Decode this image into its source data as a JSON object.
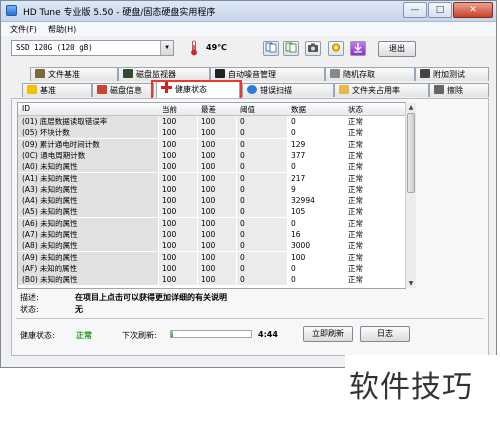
{
  "window": {
    "title": "HD Tune 专业版 5.50 - 硬盘/固态硬盘实用程序",
    "minimize": "—",
    "maximize": "□",
    "close": "✕"
  },
  "menu": {
    "file": "文件(F)",
    "help": "帮助(H)"
  },
  "toolbar": {
    "drive": "SSD 120G (120 gB)",
    "temperature": "49℃",
    "exit_label": "退出",
    "icons": [
      "copy-info-icon",
      "copy-screen-icon",
      "camera-icon",
      "options-icon",
      "download-icon"
    ]
  },
  "tabs_top": [
    {
      "label": "文件基准",
      "icon": "file-benchmark-icon"
    },
    {
      "label": "磁盘监视器",
      "icon": "disk-monitor-icon"
    },
    {
      "label": "自动噪音管理",
      "icon": "aam-icon"
    },
    {
      "label": "随机存取",
      "icon": "random-access-icon"
    },
    {
      "label": "附加测试",
      "icon": "extra-tests-icon"
    }
  ],
  "tabs_bottom": [
    {
      "label": "基准",
      "icon": "benchmark-icon"
    },
    {
      "label": "磁盘信息",
      "icon": "disk-info-icon"
    },
    {
      "label": "健康状态",
      "icon": "health-cross-icon",
      "active": true
    },
    {
      "label": "错误扫描",
      "icon": "error-scan-icon"
    },
    {
      "label": "文件夹占用率",
      "icon": "folder-usage-icon"
    },
    {
      "label": "擦除",
      "icon": "erase-icon"
    }
  ],
  "table": {
    "headers": [
      "ID",
      "当前",
      "最差",
      "阈值",
      "数据",
      "状态"
    ],
    "rows": [
      [
        "(01) 底层数据读取错误率",
        "100",
        "100",
        "0",
        "0",
        "正常"
      ],
      [
        "(05) 坏块计数",
        "100",
        "100",
        "0",
        "0",
        "正常"
      ],
      [
        "(09) 累计通电时间计数",
        "100",
        "100",
        "0",
        "129",
        "正常"
      ],
      [
        "(0C) 通电周期计数",
        "100",
        "100",
        "0",
        "377",
        "正常"
      ],
      [
        "(A0) 未知的属性",
        "100",
        "100",
        "0",
        "0",
        "正常"
      ],
      [
        "(A1) 未知的属性",
        "100",
        "100",
        "0",
        "217",
        "正常"
      ],
      [
        "(A3) 未知的属性",
        "100",
        "100",
        "0",
        "9",
        "正常"
      ],
      [
        "(A4) 未知的属性",
        "100",
        "100",
        "0",
        "32994",
        "正常"
      ],
      [
        "(A5) 未知的属性",
        "100",
        "100",
        "0",
        "105",
        "正常"
      ],
      [
        "(A6) 未知的属性",
        "100",
        "100",
        "0",
        "0",
        "正常"
      ],
      [
        "(A7) 未知的属性",
        "100",
        "100",
        "0",
        "16",
        "正常"
      ],
      [
        "(A8) 未知的属性",
        "100",
        "100",
        "0",
        "3000",
        "正常"
      ],
      [
        "(A9) 未知的属性",
        "100",
        "100",
        "0",
        "100",
        "正常"
      ],
      [
        "(AF) 未知的属性",
        "100",
        "100",
        "0",
        "0",
        "正常"
      ],
      [
        "(B0) 未知的属性",
        "100",
        "100",
        "0",
        "0",
        "正常"
      ]
    ]
  },
  "details": {
    "desc_label": "描述:",
    "desc_value": "在项目上点击可以获得更加详细的有关说明",
    "status_label": "状态:",
    "status_value": "无"
  },
  "footer": {
    "health_label": "健康状态:",
    "health_value": "正常",
    "next_refresh_label": "下次刷新:",
    "countdown": "4:44",
    "refresh_progress": 0.03,
    "refresh_button": "立即刷新",
    "log_button": "日志"
  },
  "watermark": "软件技巧",
  "colors": {
    "highlight": "#e43a2f",
    "health_ok": "#1a9a1a",
    "active_cross": "#d32020"
  }
}
